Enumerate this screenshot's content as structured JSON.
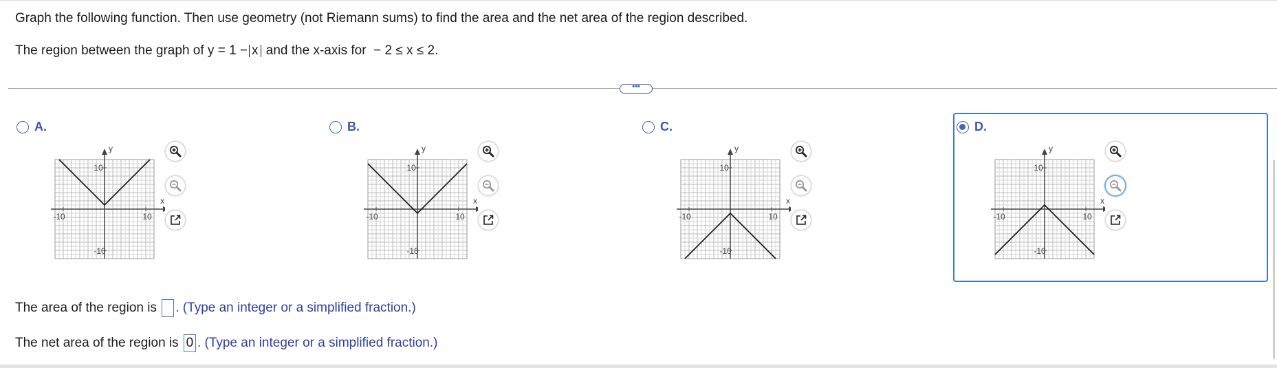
{
  "question": {
    "line1": "Graph the following function. Then use geometry (not Riemann sums) to find the area and the net area of the region described.",
    "line2_prefix": "The region between the graph of y = 1 −",
    "abs_var": "x",
    "line2_mid": "and the x-axis for",
    "line2_domain": "− 2 ≤ x ≤ 2."
  },
  "more_button_label": "•••",
  "axis_labels": {
    "x": "x",
    "y": "y",
    "top": "10",
    "bottom": "-10",
    "left": "-10",
    "right": "10"
  },
  "options": [
    {
      "letter": "A.",
      "selected": false,
      "graph": {
        "vertex": [
          0,
          1
        ],
        "opens": "up"
      }
    },
    {
      "letter": "B.",
      "selected": false,
      "graph": {
        "vertex": [
          0,
          -1
        ],
        "opens": "up"
      }
    },
    {
      "letter": "C.",
      "selected": false,
      "graph": {
        "vertex": [
          0,
          -1
        ],
        "opens": "down"
      }
    },
    {
      "letter": "D.",
      "selected": true,
      "graph": {
        "vertex": [
          0,
          1
        ],
        "opens": "down"
      }
    }
  ],
  "tools": [
    "zoom-in-icon",
    "zoom-out-icon",
    "external-link-icon"
  ],
  "answers": {
    "area_prefix": "The area of the region is",
    "area_value": "",
    "area_hint": ". (Type an integer or a simplified fraction.)",
    "net_prefix": "The net area of the region is",
    "net_value": "0",
    "net_hint": ". (Type an integer or a simplified fraction.)"
  },
  "colors": {
    "accent": "#3b55b6",
    "selected_border": "#3b79c6",
    "hint": "#2c3fa0"
  }
}
